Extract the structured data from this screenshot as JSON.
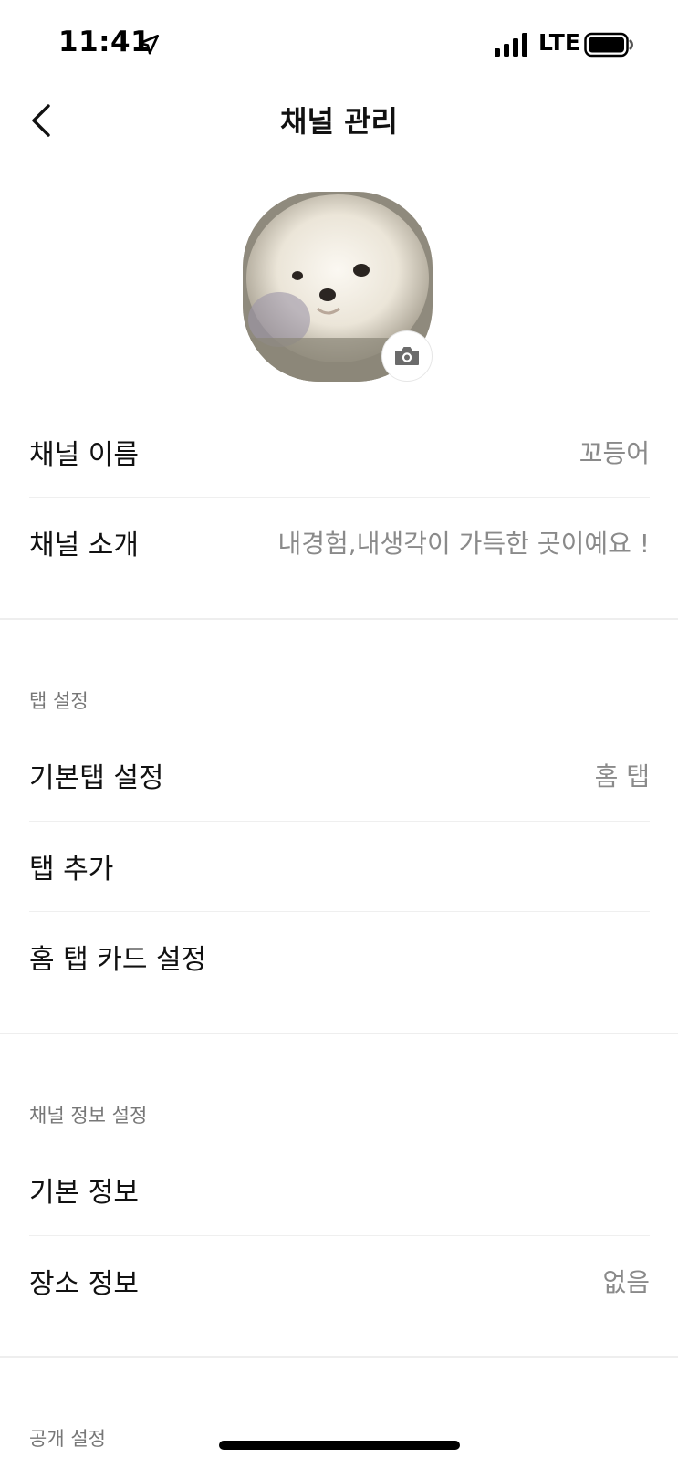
{
  "status_bar": {
    "time": "11:41",
    "network": "LTE",
    "icons": [
      "location-arrow-icon",
      "signal-bars-icon",
      "battery-icon"
    ]
  },
  "header": {
    "title": "채널 관리",
    "back_icon": "chevron-left-icon"
  },
  "profile": {
    "avatar_description_icon": "avatar",
    "camera_icon": "camera-icon"
  },
  "channel": {
    "name_label": "채널 이름",
    "name_value": "꼬등어",
    "intro_label": "채널 소개",
    "intro_value": "내경험,내생각이 가득한 곳이예요 !"
  },
  "tab_settings": {
    "header": "탭 설정",
    "default_tab_label": "기본탭 설정",
    "default_tab_value": "홈 탭",
    "add_tab_label": "탭 추가",
    "home_tab_card_label": "홈 탭 카드 설정"
  },
  "channel_info": {
    "header": "채널 정보 설정",
    "basic_info_label": "기본 정보",
    "location_info_label": "장소 정보",
    "location_info_value": "없음"
  },
  "public_settings": {
    "header": "공개 설정"
  },
  "colors": {
    "text_primary": "#111111",
    "text_secondary": "#8a8a8a",
    "section_header": "#777777",
    "divider": "#eeeeee"
  }
}
